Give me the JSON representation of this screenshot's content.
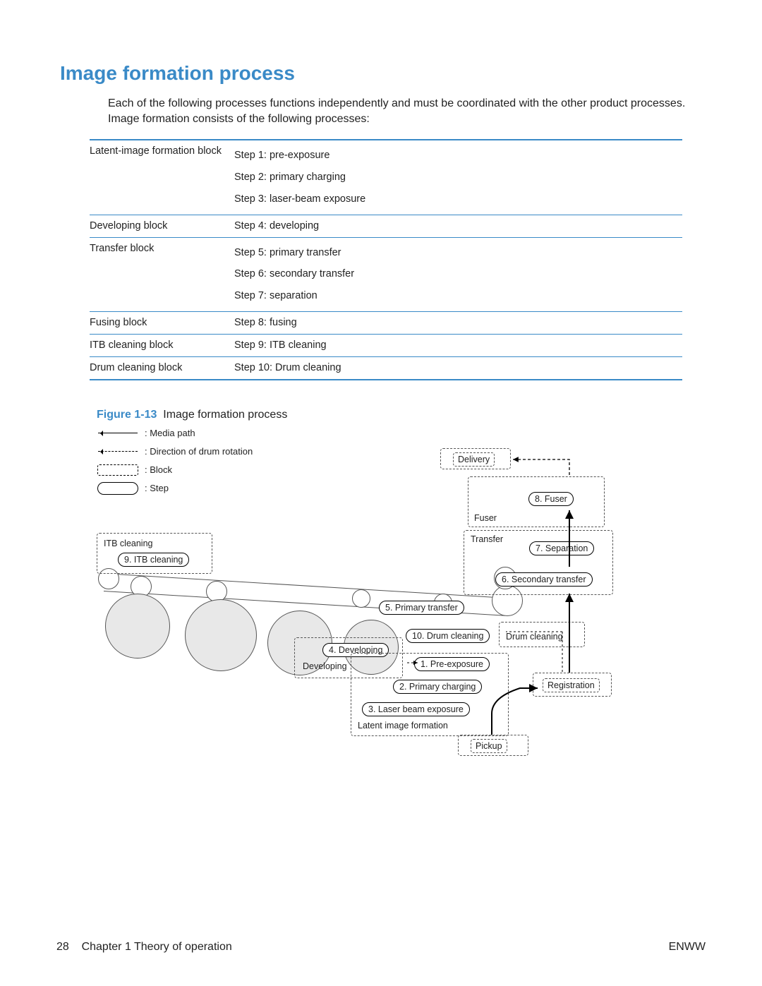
{
  "heading": "Image formation process",
  "intro": "Each of the following processes functions independently and must be coordinated with the other product processes. Image formation consists of the following processes:",
  "table": {
    "rows": [
      {
        "group": "Latent-image formation block",
        "steps": [
          "Step 1: pre-exposure",
          "Step 2: primary charging",
          "Step 3: laser-beam exposure"
        ]
      },
      {
        "group": "Developing block",
        "steps": [
          "Step 4: developing"
        ]
      },
      {
        "group": "Transfer block",
        "steps": [
          "Step 5: primary transfer",
          "Step 6: secondary transfer",
          "Step 7: separation"
        ]
      },
      {
        "group": "Fusing block",
        "steps": [
          "Step 8: fusing"
        ]
      },
      {
        "group": "ITB cleaning block",
        "steps": [
          "Step 9: ITB cleaning"
        ]
      },
      {
        "group": "Drum cleaning block",
        "steps": [
          "Step 10: Drum cleaning"
        ]
      }
    ]
  },
  "figure": {
    "num": "Figure 1-13",
    "title": "Image formation process"
  },
  "legend": {
    "media_path": ": Media path",
    "drum_rotation": ": Direction of drum rotation",
    "block": ": Block",
    "step": ": Step"
  },
  "diagram": {
    "itb_cleaning_blk": "ITB cleaning",
    "itb_cleaning_step": "9. ITB cleaning",
    "delivery": "Delivery",
    "fuser_step": "8. Fuser",
    "fuser_blk": "Fuser",
    "transfer_blk": "Transfer",
    "separation_step": "7. Separation",
    "secondary_transfer_step": "6. Secondary transfer",
    "primary_transfer_step": "5. Primary transfer",
    "drum_cleaning_step": "10. Drum cleaning",
    "drum_cleaning_blk": "Drum cleaning",
    "developing_step": "4. Developing",
    "developing_blk": "Developing",
    "pre_exposure_step": "1. Pre-exposure",
    "primary_charging_step": "2. Primary charging",
    "laser_beam_step": "3. Laser beam exposure",
    "latent_image_blk": "Latent image formation",
    "registration": "Registration",
    "pickup": "Pickup"
  },
  "footer": {
    "page_num": "28",
    "chapter": "Chapter 1   Theory of operation",
    "right": "ENWW"
  }
}
